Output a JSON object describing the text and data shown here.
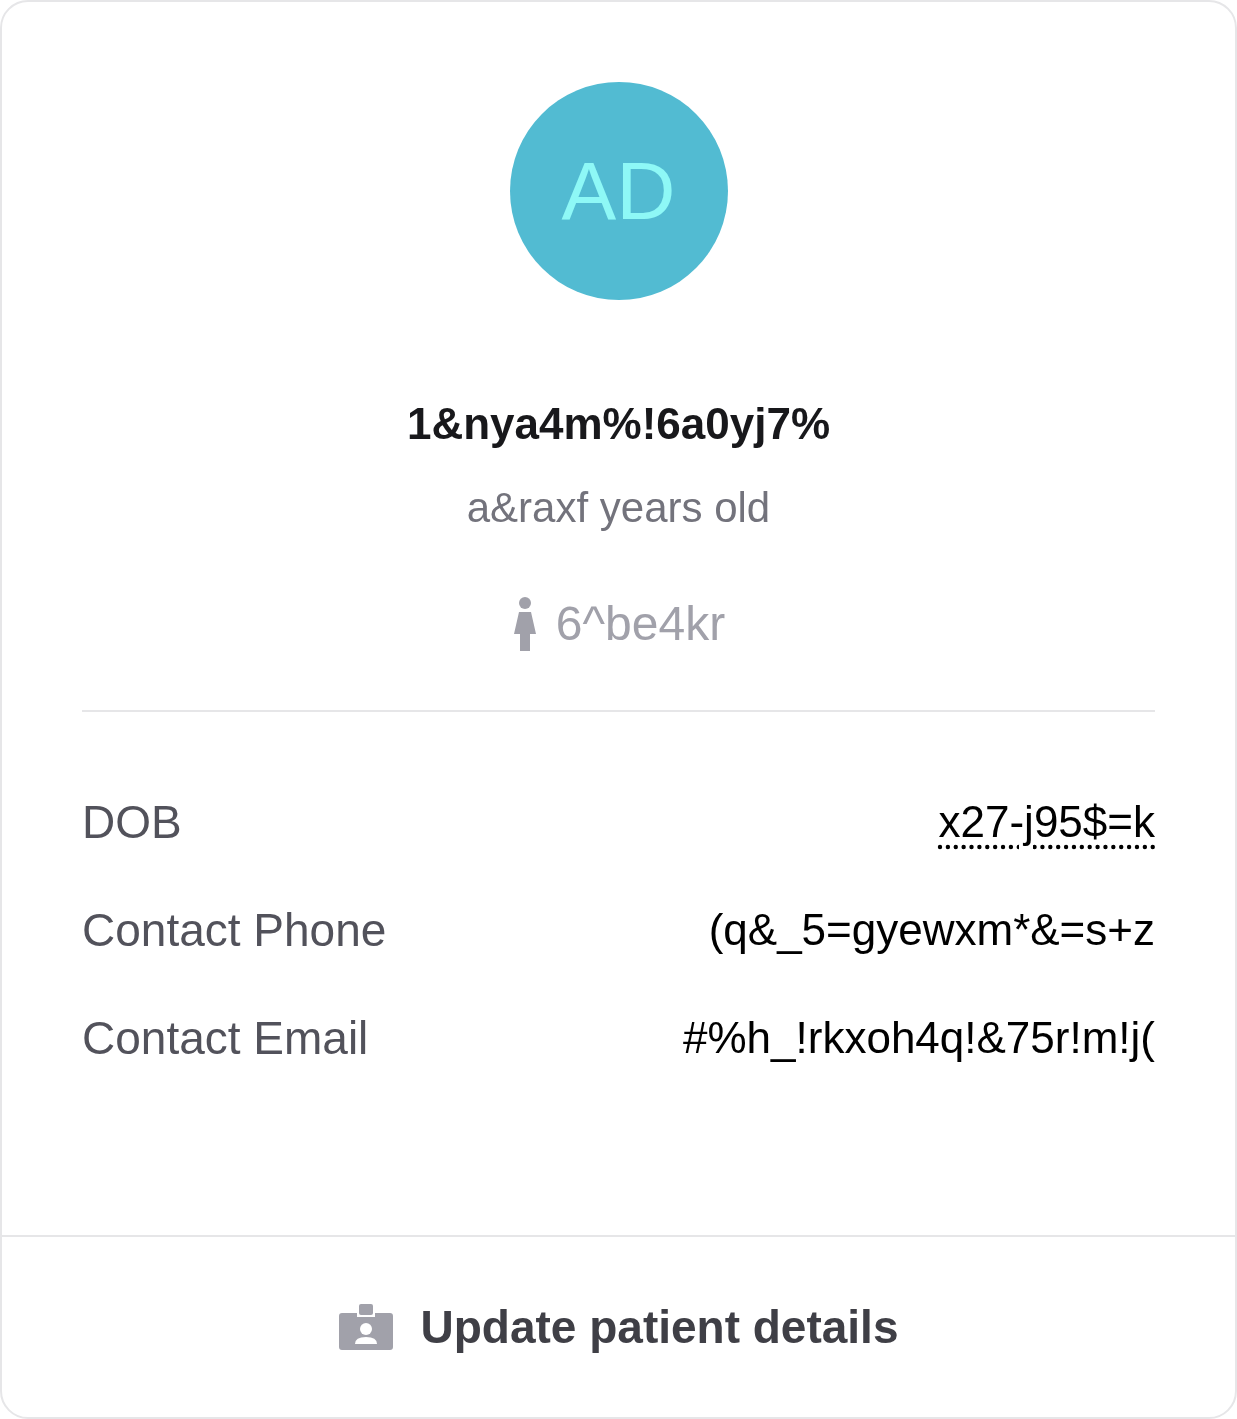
{
  "avatar": {
    "initials": "AD"
  },
  "patient": {
    "name": "1&nya4m%!6a0yj7%",
    "age": "a&raxf years old",
    "gender": "6^be4kr"
  },
  "details": [
    {
      "label": "DOB",
      "value": "x27-j95$=k",
      "kind": "abbr"
    },
    {
      "label": "Contact Phone",
      "value": "(q&_5=gyewxm*&=s+z",
      "kind": "text"
    },
    {
      "label": "Contact Email",
      "value": "#%h_!rkxoh4q!&75r!m!j(",
      "kind": "text"
    }
  ],
  "action": {
    "label": "Update patient details"
  }
}
